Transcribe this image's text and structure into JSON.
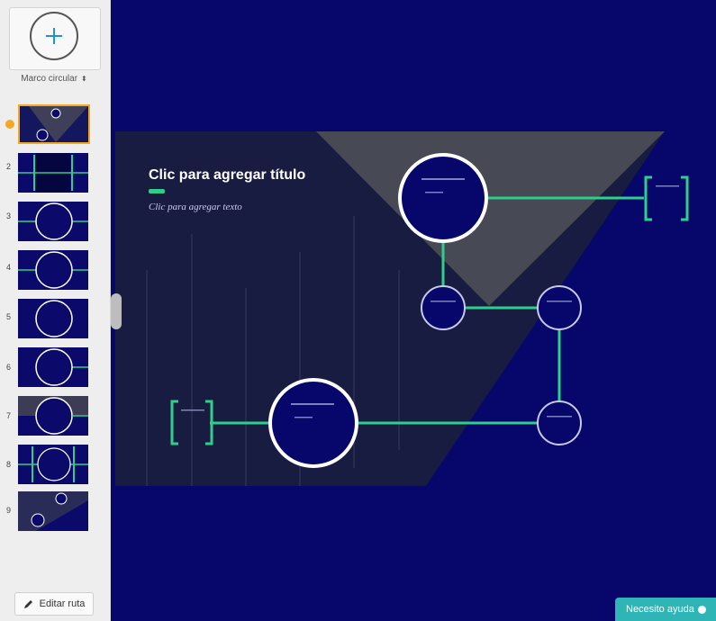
{
  "sidebar": {
    "frame_type": "Marco circular",
    "thumbnails": [
      {
        "number": "",
        "current": true
      },
      {
        "number": "2"
      },
      {
        "number": "3"
      },
      {
        "number": "4"
      },
      {
        "number": "5"
      },
      {
        "number": "6"
      },
      {
        "number": "7"
      },
      {
        "number": "8"
      },
      {
        "number": "9"
      }
    ],
    "edit_path_label": "Editar ruta"
  },
  "slide": {
    "title": "Clic para agregar título",
    "subtitle": "Clic para agregar texto"
  },
  "help_button": {
    "label": "Necesito ayuda"
  },
  "colors": {
    "canvas": "#06066b",
    "accent": "#2ecf8a",
    "current": "#f5a623",
    "help": "#2fb5b5"
  },
  "icons": [
    "plus-icon",
    "pencil-icon",
    "sort-arrows-icon",
    "help-icon"
  ]
}
